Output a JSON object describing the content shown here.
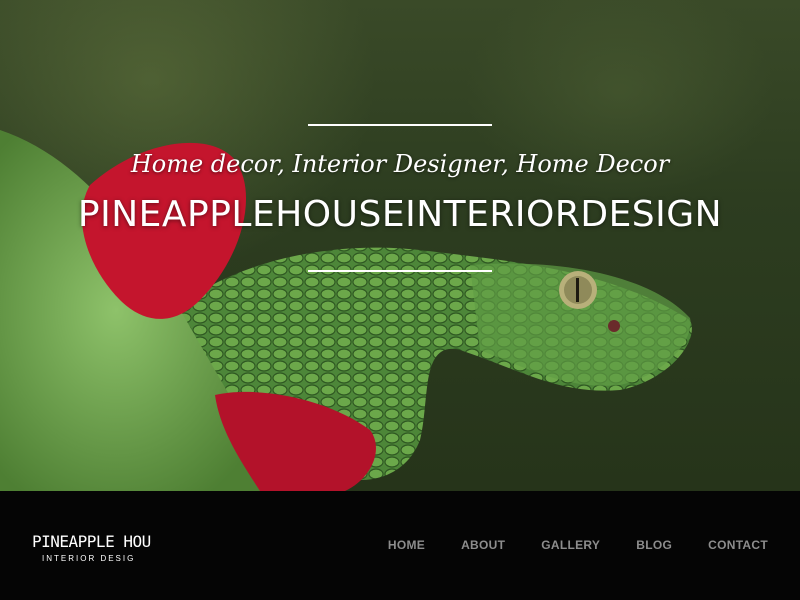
{
  "hero": {
    "tagline": "Home decor, Interior Designer, Home Decor",
    "title": "PINEAPPLEHOUSEINTERIORDESIGN"
  },
  "header": {
    "logo_main": "PINEAPPLE HOU",
    "logo_sub": "INTERIOR DESIG"
  },
  "nav": {
    "items": [
      {
        "label": "HOME"
      },
      {
        "label": "ABOUT"
      },
      {
        "label": "GALLERY"
      },
      {
        "label": "BLOG"
      },
      {
        "label": "CONTACT"
      }
    ]
  },
  "colors": {
    "nav_text": "#8d8d8d",
    "navbar_bg": "#050505",
    "hero_text": "#ffffff"
  }
}
